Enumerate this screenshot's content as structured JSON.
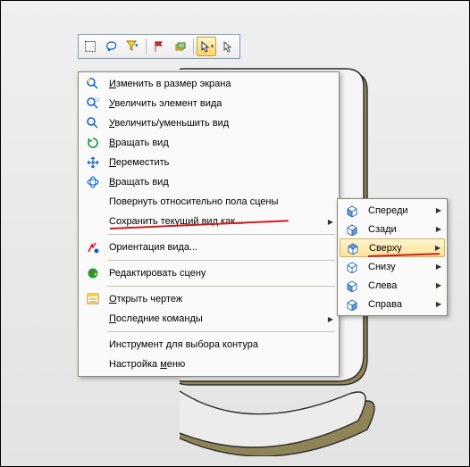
{
  "toolbar": {
    "buttons": [
      {
        "name": "select-box-icon"
      },
      {
        "name": "lasso-icon"
      },
      {
        "name": "filter-icon"
      },
      {
        "name": "flag-icon"
      },
      {
        "name": "pick-icon"
      },
      {
        "name": "cursor-icon"
      },
      {
        "name": "cursor-alt-icon"
      }
    ]
  },
  "menu": {
    "zoom_fit": "зменить в размер экрана",
    "zoom_in": "величить элемент вида",
    "zoom": "величить/уменьшить вид",
    "rotate": "ращать вид",
    "pan": "ереместить",
    "rotate2": "ращать вид",
    "roll": "Повернуть относительно пола сцены",
    "save_view": "Сохранить текущий вид как...",
    "orient": "Ориентация вида...",
    "edit_scene": "Редактировать сцену",
    "open_dwg": "ткрыть чертеж",
    "recent": "оследние команды",
    "contour": "Инструмент для выбора контура",
    "menu_cfg": "Настройка ",
    "menu_cfg2": "еню",
    "u_i": "И",
    "u_u": "У",
    "u_v": "В",
    "u_p": "П",
    "u_o": "О",
    "u_m": "м"
  },
  "submenu": {
    "front": "Спереди",
    "back": "Сзади",
    "top": "Сверху",
    "bottom": "Снизу",
    "left": "Слева",
    "right": "Справа"
  }
}
